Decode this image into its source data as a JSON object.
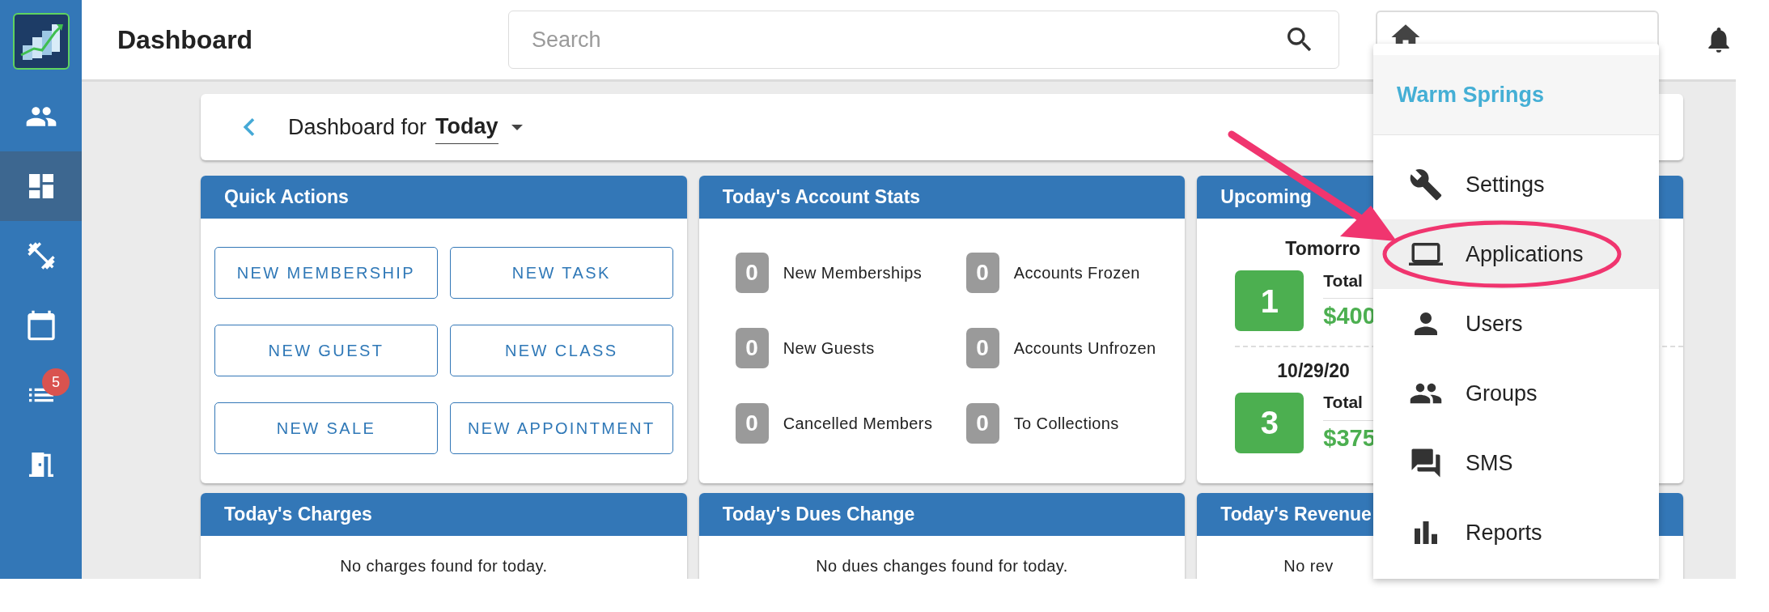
{
  "sidebar": {
    "items": [
      {
        "kind": "members",
        "selected": false
      },
      {
        "kind": "dashboard",
        "selected": true
      },
      {
        "kind": "fitness",
        "selected": false
      },
      {
        "kind": "calendar",
        "selected": false
      },
      {
        "kind": "list",
        "selected": false,
        "badge": "5"
      },
      {
        "kind": "exit",
        "selected": false
      }
    ]
  },
  "header": {
    "title": "Dashboard",
    "search": {
      "placeholder": "Search"
    },
    "location_selector": {
      "kind": "home"
    }
  },
  "dashboard_bar": {
    "label": "Dashboard for",
    "period": "Today"
  },
  "cards": [
    {
      "kind": "actions",
      "title": "Quick Actions",
      "buttons": [
        "NEW MEMBERSHIP",
        "NEW TASK",
        "NEW GUEST",
        "NEW CLASS",
        "NEW SALE",
        "NEW APPOINTMENT"
      ]
    },
    {
      "kind": "stats",
      "title": "Today's Account Stats",
      "stats": [
        {
          "count": "0",
          "label": "New Memberships"
        },
        {
          "count": "0",
          "label": "Accounts Frozen"
        },
        {
          "count": "0",
          "label": "New Guests"
        },
        {
          "count": "0",
          "label": "Accounts Unfrozen"
        },
        {
          "count": "0",
          "label": "Cancelled Members"
        },
        {
          "count": "0",
          "label": "To Collections"
        }
      ]
    },
    {
      "kind": "upcoming",
      "title": "Upcoming",
      "groups": [
        {
          "date": "Tomorro",
          "count": "1",
          "total_label": "Total",
          "amount": "$400"
        },
        {
          "date": "10/29/20",
          "count": "3",
          "total_label": "Total",
          "amount": "$375"
        }
      ]
    },
    {
      "kind": "message",
      "title": "Today's Charges",
      "message": "No charges found for today."
    },
    {
      "kind": "message",
      "title": "Today's Dues Change",
      "message": "No dues changes found for today."
    },
    {
      "kind": "message",
      "title": "Today's Revenue",
      "message": "No rev"
    }
  ],
  "location_menu": {
    "title": "Warm Springs",
    "items": [
      {
        "kind": "settings",
        "label": "Settings",
        "selected": false
      },
      {
        "kind": "applications",
        "label": "Applications",
        "selected": true
      },
      {
        "kind": "users",
        "label": "Users",
        "selected": false
      },
      {
        "kind": "groups",
        "label": "Groups",
        "selected": false
      },
      {
        "kind": "sms",
        "label": "SMS",
        "selected": false
      },
      {
        "kind": "reports",
        "label": "Reports",
        "selected": false
      }
    ]
  }
}
